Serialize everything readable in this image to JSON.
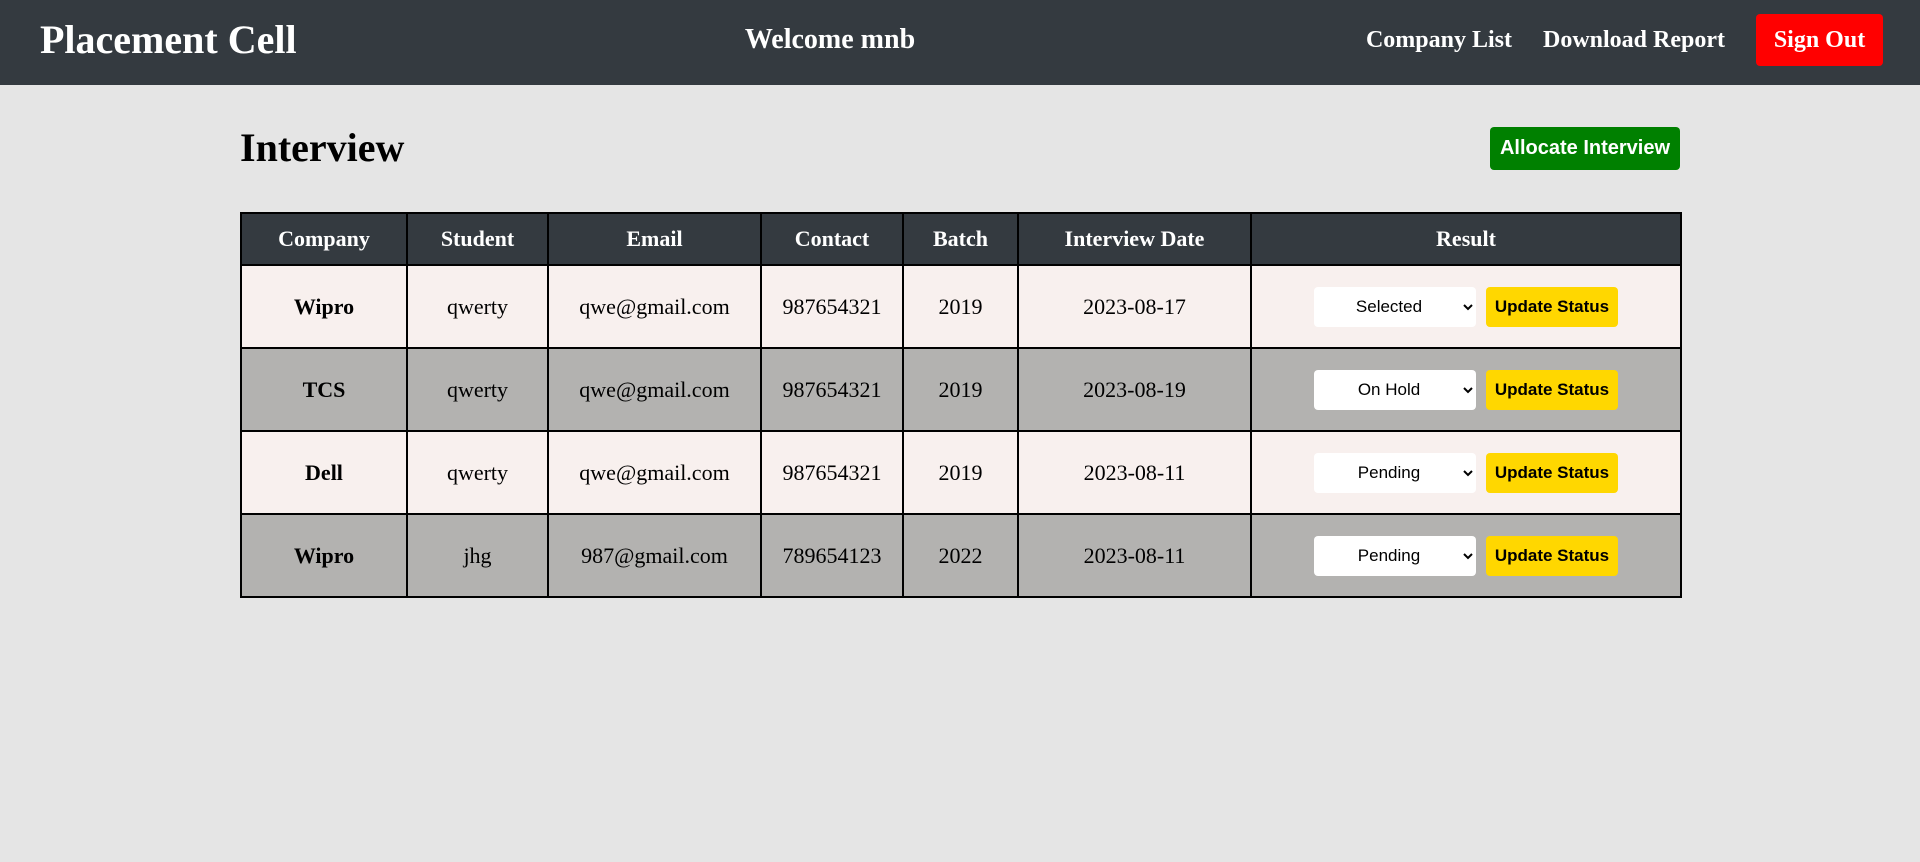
{
  "navbar": {
    "brand": "Placement Cell",
    "welcome": "Welcome mnb",
    "company_list": "Company List",
    "download_report": "Download Report",
    "sign_out": "Sign Out"
  },
  "page": {
    "title": "Interview",
    "allocate_button": "Allocate Interview"
  },
  "table": {
    "headers": [
      "Company",
      "Student",
      "Email",
      "Contact",
      "Batch",
      "Interview Date",
      "Result"
    ],
    "update_label": "Update Status",
    "rows": [
      {
        "company": "Wipro",
        "student": "qwerty",
        "email": "qwe@gmail.com",
        "contact": "987654321",
        "batch": "2019",
        "date": "2023-08-17",
        "result": "Selected"
      },
      {
        "company": "TCS",
        "student": "qwerty",
        "email": "qwe@gmail.com",
        "contact": "987654321",
        "batch": "2019",
        "date": "2023-08-19",
        "result": "On Hold"
      },
      {
        "company": "Dell",
        "student": "qwerty",
        "email": "qwe@gmail.com",
        "contact": "987654321",
        "batch": "2019",
        "date": "2023-08-11",
        "result": "Pending"
      },
      {
        "company": "Wipro",
        "student": "jhg",
        "email": "987@gmail.com",
        "contact": "789654123",
        "batch": "2022",
        "date": "2023-08-11",
        "result": "Pending"
      }
    ]
  },
  "colors": {
    "navbar_bg": "#343a40",
    "page_bg": "#e5e5e5",
    "sign_out_bg": "#ff0000",
    "allocate_bg": "#008000",
    "update_bg": "#ffd700",
    "row_light": "#f8f0ee",
    "row_dark": "#b3b2b0"
  }
}
